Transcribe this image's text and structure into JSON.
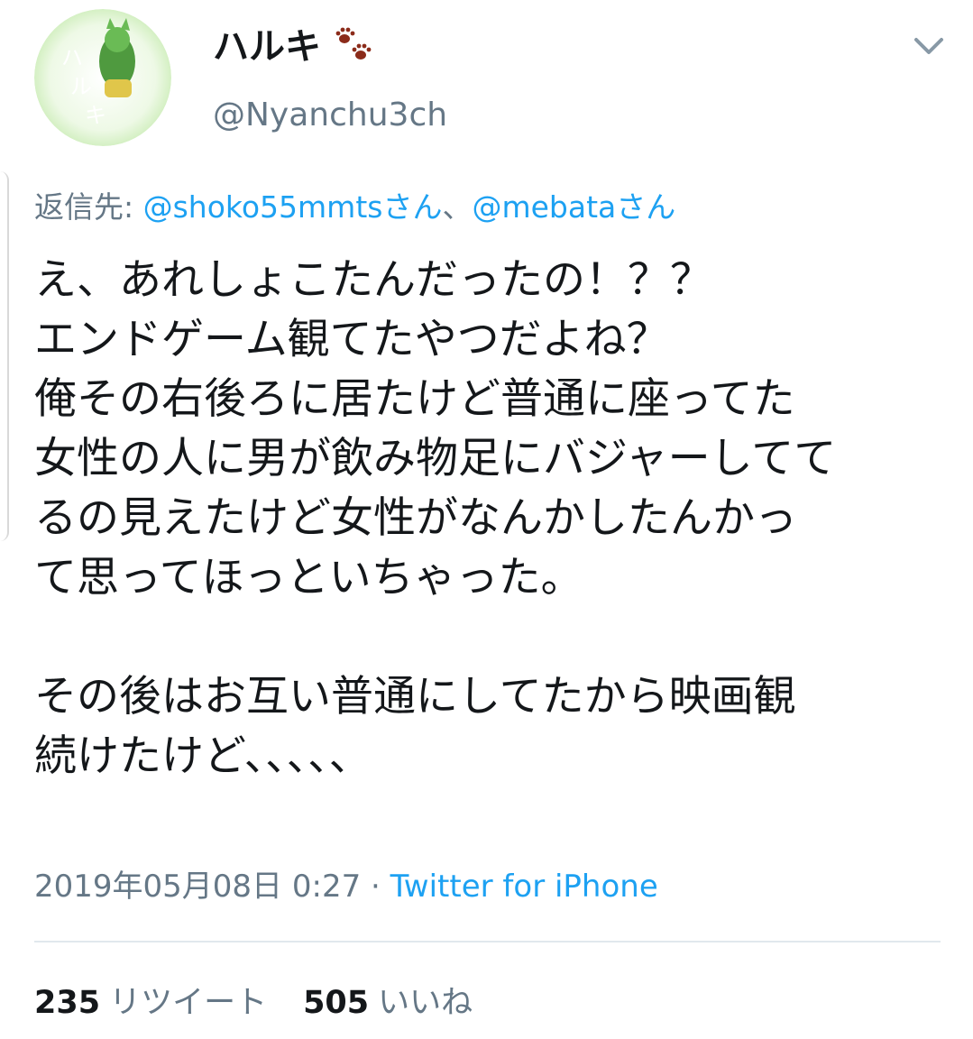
{
  "user": {
    "display_name": "ハルキ",
    "name_emoji_icon": "paw-prints-icon",
    "handle": "@Nyanchu3ch",
    "avatar_icon": "avatar-green-character",
    "avatar_text": [
      "ハ",
      "ル",
      "キ"
    ]
  },
  "menu_icon": "chevron-down-icon",
  "reply": {
    "prefix": "返信先: ",
    "mention_1": "@shoko55mmtsさん",
    "separator": "、",
    "mention_2": "@mebataさん"
  },
  "tweet": {
    "lines": [
      "え、あれしょこたんだったの！？？",
      "エンドゲーム観てたやつだよね？",
      "俺その右後ろに居たけど普通に座ってた",
      "女性の人に男が飲み物足にバジャーしてて",
      "るの見えたけど女性がなんかしたんかっ",
      "て思ってほっといちゃった。",
      "",
      "その後はお互い普通にしてたから映画観",
      "続けたけど、、、、、"
    ]
  },
  "meta": {
    "timestamp": "2019年05月08日 0:27",
    "dot": " · ",
    "source": "Twitter for iPhone"
  },
  "stats": {
    "retweet_count": "235",
    "retweet_label": "リツイート",
    "like_count": "505",
    "like_label": "いいね"
  },
  "colors": {
    "text": "#14171a",
    "secondary": "#657786",
    "link": "#1da1f2",
    "divider": "#e1e8ed"
  }
}
